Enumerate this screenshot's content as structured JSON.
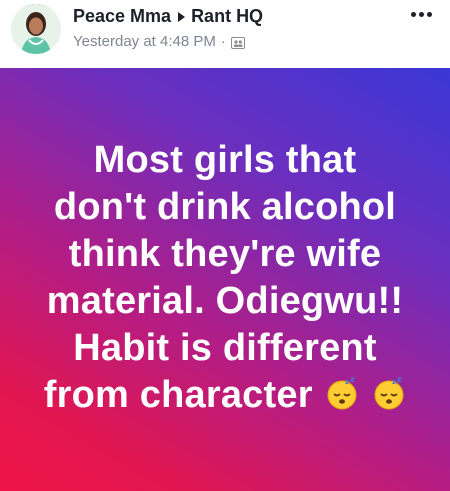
{
  "header": {
    "author": "Peace Mma",
    "group": "Rant HQ",
    "timestamp": "Yesterday at 4:48 PM",
    "separator": "·",
    "audience_icon": "group-icon",
    "more_icon": "more-options-icon"
  },
  "post": {
    "lines": [
      "Most girls that",
      "don't drink alcohol",
      "think they're wife",
      "material. Odiegwu!!",
      "Habit is different",
      "from character"
    ],
    "emojis": [
      "sleeping-face",
      "sleeping-face"
    ],
    "colors": {
      "gradient_start": "#3a37d6",
      "gradient_mid": "#b21d86",
      "gradient_end": "#ee1347",
      "text": "#ffffff"
    }
  }
}
